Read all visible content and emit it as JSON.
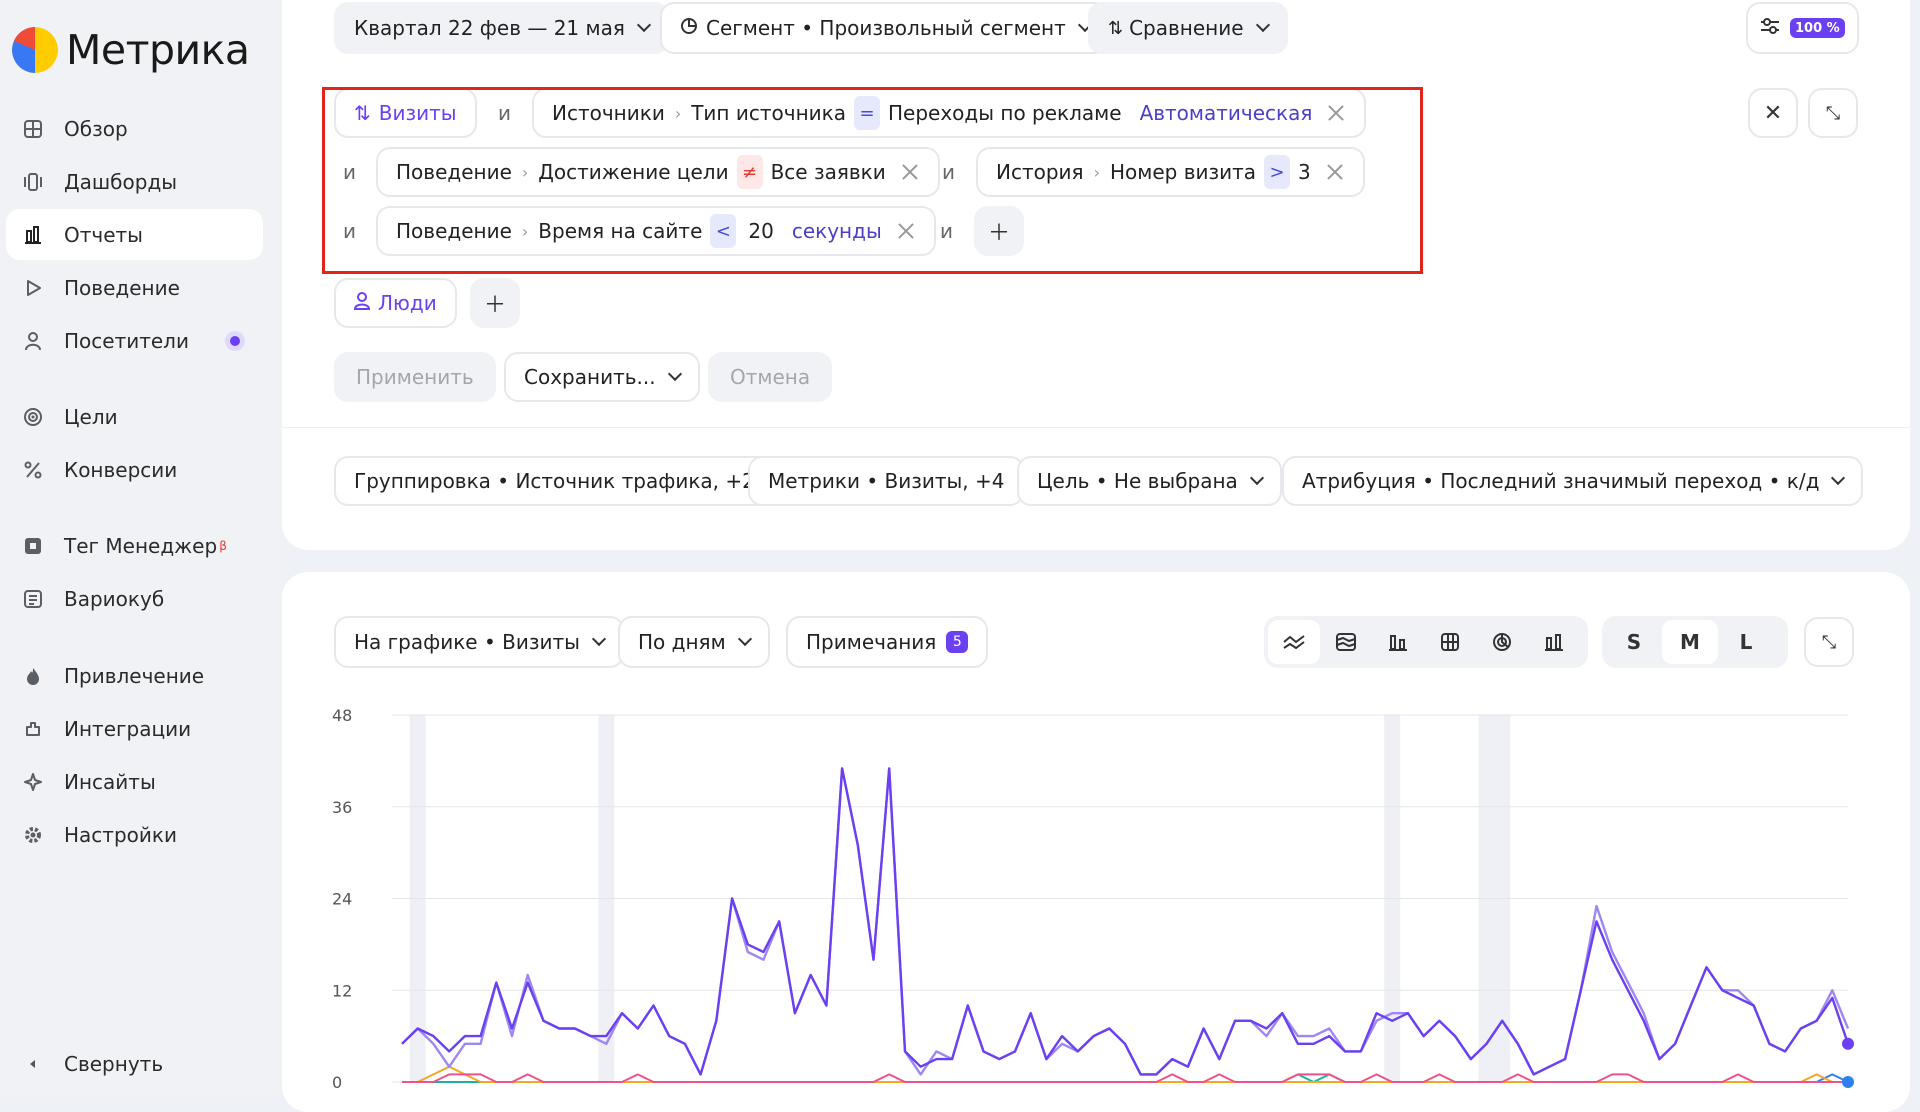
{
  "app": {
    "name": "Метрика"
  },
  "sidebar": {
    "items": [
      {
        "label": "Обзор",
        "icon": "overview-icon"
      },
      {
        "label": "Дашборды",
        "icon": "dashboards-icon"
      },
      {
        "label": "Отчеты",
        "icon": "reports-icon",
        "active": true
      },
      {
        "label": "Поведение",
        "icon": "behavior-icon"
      },
      {
        "label": "Посетители",
        "icon": "visitors-icon"
      },
      {
        "label": "Цели",
        "icon": "goals-icon"
      },
      {
        "label": "Конверсии",
        "icon": "conversions-icon"
      },
      {
        "label": "Тег Менеджер",
        "icon": "tag-manager-icon",
        "sup": "β"
      },
      {
        "label": "Вариокуб",
        "icon": "variokub-icon"
      },
      {
        "label": "Привлечение",
        "icon": "acquisition-icon"
      },
      {
        "label": "Интеграции",
        "icon": "integrations-icon"
      },
      {
        "label": "Инсайты",
        "icon": "insights-icon"
      },
      {
        "label": "Настройки",
        "icon": "settings-icon"
      }
    ],
    "collapse": "Свернуть"
  },
  "toolbar": {
    "period": "Квартал 22 фев — 21 мая",
    "segment": "Сегмент • Произвольный сегмент",
    "compare": "Сравнение",
    "zoom": "100 %"
  },
  "filters": {
    "visits_tag": "Визиты",
    "and": "и",
    "row1": {
      "a": "Источники",
      "b": "Тип источника",
      "op": "=",
      "value": "Переходы по рекламе",
      "value2": "Автоматическая"
    },
    "row2a": {
      "a": "Поведение",
      "b": "Достижение цели",
      "op": "≠",
      "value": "Все заявки"
    },
    "row2b": {
      "a": "История",
      "b": "Номер визита",
      "op": ">",
      "value": "3"
    },
    "row3": {
      "a": "Поведение",
      "b": "Время на сайте",
      "op": "<",
      "value": "20",
      "unit": "секунды"
    },
    "people_tag": "Люди"
  },
  "actions": {
    "apply": "Применить",
    "save": "Сохранить...",
    "cancel": "Отмена"
  },
  "settings": {
    "grouping": "Группировка • Источник трафика, +2",
    "metrics": "Метрики • Визиты, +4",
    "goal": "Цель • Не выбрана",
    "attribution": "Атрибуция • Последний значимый переход • к/д"
  },
  "chart_controls": {
    "on_chart": "На графике • Визиты",
    "by_days": "По дням",
    "notes": "Примечания",
    "notes_count": "5",
    "sizes": [
      "S",
      "M",
      "L"
    ]
  },
  "chart_data": {
    "type": "line",
    "ylim": [
      0,
      48
    ],
    "yticks": [
      "48",
      "36",
      "24",
      "12",
      "0"
    ],
    "series": [
      {
        "color": "#6b3ff2",
        "values": [
          5,
          7,
          6,
          4,
          6,
          6,
          13,
          7,
          13,
          8,
          7,
          7,
          6,
          6,
          9,
          7,
          10,
          6,
          5,
          1,
          8,
          24,
          18,
          17,
          21,
          9,
          14,
          10,
          41,
          31,
          16,
          41,
          4,
          2,
          3,
          3,
          10,
          4,
          3,
          4,
          9,
          3,
          6,
          4,
          6,
          7,
          5,
          1,
          1,
          3,
          2,
          7,
          3,
          8,
          8,
          7,
          9,
          5,
          5,
          6,
          4,
          4,
          9,
          8,
          9,
          6,
          8,
          6,
          3,
          5,
          8,
          5,
          1,
          2,
          3,
          12,
          21,
          16,
          12,
          8,
          3,
          5,
          10,
          15,
          12,
          11,
          10,
          5,
          4,
          7,
          8,
          11,
          5
        ]
      },
      {
        "color": "#9d87f5",
        "values": [
          5,
          7,
          5,
          2,
          5,
          5,
          13,
          6,
          14,
          8,
          7,
          7,
          6,
          5,
          9,
          7,
          10,
          6,
          5,
          1,
          8,
          24,
          17,
          16,
          21,
          9,
          14,
          10,
          41,
          31,
          16,
          41,
          4,
          1,
          4,
          3,
          10,
          4,
          3,
          4,
          9,
          3,
          5,
          4,
          6,
          7,
          5,
          1,
          1,
          3,
          2,
          7,
          3,
          8,
          8,
          6,
          9,
          6,
          6,
          7,
          4,
          4,
          8,
          9,
          9,
          6,
          8,
          6,
          3,
          5,
          8,
          5,
          1,
          2,
          3,
          12,
          23,
          17,
          13,
          9,
          3,
          5,
          10,
          15,
          12,
          12,
          10,
          5,
          4,
          7,
          8,
          12,
          7
        ]
      },
      {
        "color": "#f0508c",
        "values": [
          0,
          0,
          0,
          1,
          1,
          1,
          0,
          0,
          1,
          0,
          0,
          0,
          0,
          0,
          0,
          1,
          0,
          0,
          0,
          0,
          0,
          0,
          0,
          0,
          0,
          0,
          0,
          0,
          0,
          0,
          0,
          1,
          0,
          0,
          0,
          0,
          0,
          0,
          0,
          0,
          0,
          0,
          0,
          0,
          0,
          0,
          0,
          0,
          0,
          1,
          0,
          0,
          1,
          0,
          0,
          0,
          0,
          1,
          1,
          1,
          0,
          0,
          1,
          0,
          0,
          0,
          1,
          0,
          0,
          0,
          0,
          1,
          0,
          0,
          0,
          0,
          0,
          1,
          1,
          0,
          0,
          0,
          0,
          0,
          0,
          1,
          0,
          0,
          0,
          0,
          0,
          0,
          0
        ]
      },
      {
        "color": "#f5a623",
        "values": [
          0,
          0,
          1,
          2,
          1,
          0,
          0,
          0,
          0,
          0,
          0,
          0,
          0,
          0,
          0,
          0,
          0,
          0,
          0,
          0,
          0,
          0,
          0,
          0,
          0,
          0,
          0,
          0,
          0,
          0,
          0,
          0,
          0,
          0,
          0,
          0,
          0,
          0,
          0,
          0,
          0,
          0,
          0,
          0,
          0,
          0,
          0,
          0,
          0,
          0,
          0,
          0,
          0,
          0,
          0,
          0,
          0,
          0,
          0,
          0,
          0,
          0,
          0,
          0,
          0,
          0,
          0,
          0,
          0,
          0,
          0,
          0,
          0,
          0,
          0,
          0,
          0,
          0,
          0,
          0,
          0,
          0,
          0,
          0,
          0,
          0,
          0,
          0,
          0,
          0,
          1,
          0,
          0
        ]
      },
      {
        "color": "#1db2a0",
        "values": [
          0,
          0,
          0,
          0,
          0,
          0,
          0,
          0,
          0,
          0,
          0,
          0,
          0,
          0,
          0,
          0,
          0,
          0,
          0,
          0,
          0,
          0,
          0,
          0,
          0,
          0,
          0,
          0,
          0,
          0,
          0,
          0,
          0,
          0,
          0,
          0,
          0,
          0,
          0,
          0,
          0,
          0,
          0,
          0,
          0,
          0,
          0,
          0,
          0,
          0,
          0,
          0,
          0,
          0,
          0,
          0,
          0,
          1,
          0,
          1,
          0,
          0,
          0,
          0,
          0,
          0,
          0,
          0,
          0,
          0,
          0,
          0,
          0,
          0,
          0,
          0,
          0,
          0,
          0,
          0,
          0,
          0,
          0,
          0,
          0,
          0,
          0,
          0,
          0,
          0,
          0,
          0,
          0
        ]
      },
      {
        "color": "#2f80ed",
        "values": [
          0,
          0,
          0,
          0,
          0,
          0,
          0,
          0,
          0,
          0,
          0,
          0,
          0,
          0,
          0,
          0,
          0,
          0,
          0,
          0,
          0,
          0,
          0,
          0,
          0,
          0,
          0,
          0,
          0,
          0,
          0,
          0,
          0,
          0,
          0,
          0,
          0,
          0,
          0,
          0,
          0,
          0,
          0,
          0,
          0,
          0,
          0,
          0,
          0,
          0,
          0,
          0,
          0,
          0,
          0,
          0,
          0,
          0,
          0,
          0,
          0,
          0,
          0,
          0,
          0,
          0,
          0,
          0,
          0,
          0,
          0,
          0,
          0,
          0,
          0,
          0,
          0,
          0,
          0,
          0,
          0,
          0,
          0,
          0,
          0,
          0,
          0,
          0,
          0,
          0,
          0,
          1,
          0
        ]
      }
    ],
    "highlight_bands": [
      1,
      13,
      63,
      69,
      70
    ]
  }
}
